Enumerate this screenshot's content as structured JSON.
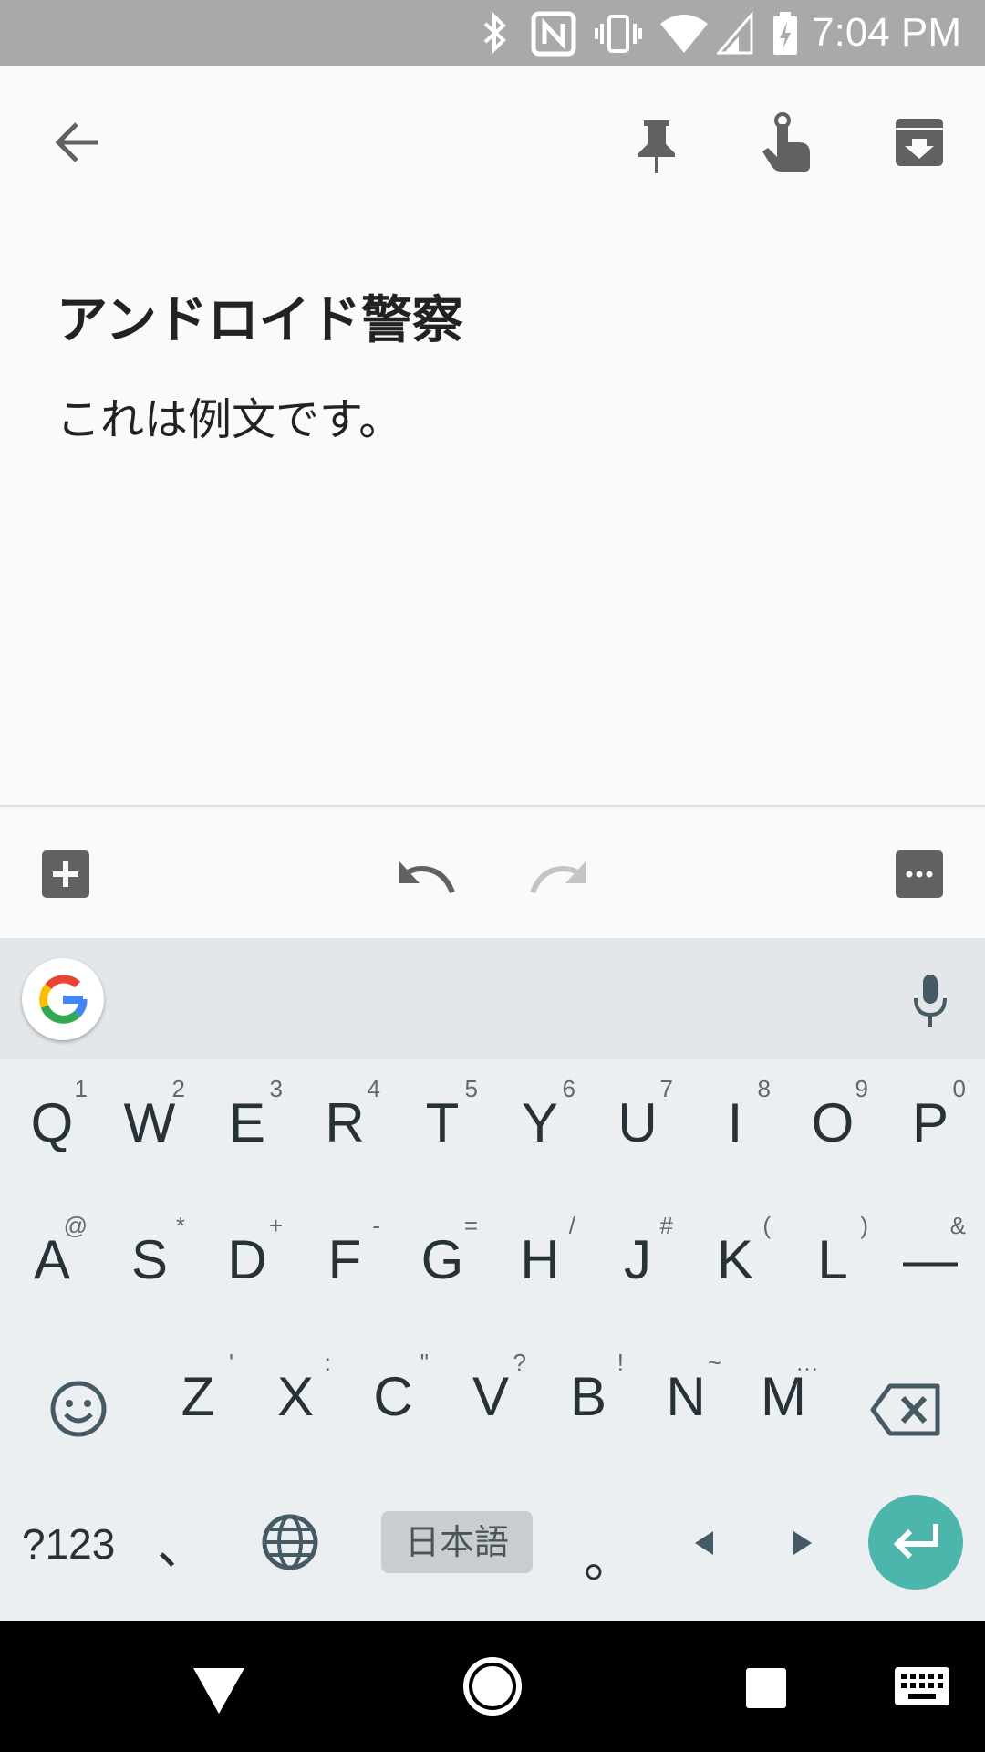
{
  "status_bar": {
    "time": "7:04 PM",
    "icons": [
      "bluetooth-icon",
      "nfc-icon",
      "vibrate-icon",
      "wifi-icon",
      "signal-icon",
      "battery-charging-icon"
    ]
  },
  "app_bar": {
    "icons": [
      "back-arrow-icon",
      "pin-icon",
      "reminder-finger-icon",
      "archive-icon"
    ]
  },
  "note": {
    "title": "アンドロイド警察",
    "body": "これは例文です。"
  },
  "toolbar": {
    "icons": [
      "add-box-icon",
      "undo-icon",
      "redo-icon",
      "more-icon"
    ]
  },
  "keyboard": {
    "rows": [
      [
        {
          "main": "Q",
          "hint": "1"
        },
        {
          "main": "W",
          "hint": "2"
        },
        {
          "main": "E",
          "hint": "3"
        },
        {
          "main": "R",
          "hint": "4"
        },
        {
          "main": "T",
          "hint": "5"
        },
        {
          "main": "Y",
          "hint": "6"
        },
        {
          "main": "U",
          "hint": "7"
        },
        {
          "main": "I",
          "hint": "8"
        },
        {
          "main": "O",
          "hint": "9"
        },
        {
          "main": "P",
          "hint": "0"
        }
      ],
      [
        {
          "main": "A",
          "hint": "@"
        },
        {
          "main": "S",
          "hint": "*"
        },
        {
          "main": "D",
          "hint": "+"
        },
        {
          "main": "F",
          "hint": "-"
        },
        {
          "main": "G",
          "hint": "="
        },
        {
          "main": "H",
          "hint": "/"
        },
        {
          "main": "J",
          "hint": "#"
        },
        {
          "main": "K",
          "hint": "("
        },
        {
          "main": "L",
          "hint": ")"
        },
        {
          "main": "—",
          "hint": "&"
        }
      ],
      [
        {
          "main": "Z",
          "hint": "'"
        },
        {
          "main": "X",
          "hint": ":"
        },
        {
          "main": "C",
          "hint": "\""
        },
        {
          "main": "V",
          "hint": "?"
        },
        {
          "main": "B",
          "hint": "!"
        },
        {
          "main": "N",
          "hint": "~"
        },
        {
          "main": "M",
          "hint": "…"
        }
      ]
    ],
    "symbols_label": "?123",
    "comma_label": "、",
    "language_label": "日本語",
    "period_label": "。",
    "accent_color": "#4db6ac"
  },
  "nav_bar": {
    "icons": [
      "back-triangle-icon",
      "home-circle-icon",
      "recents-square-icon",
      "keyboard-switch-icon"
    ]
  }
}
